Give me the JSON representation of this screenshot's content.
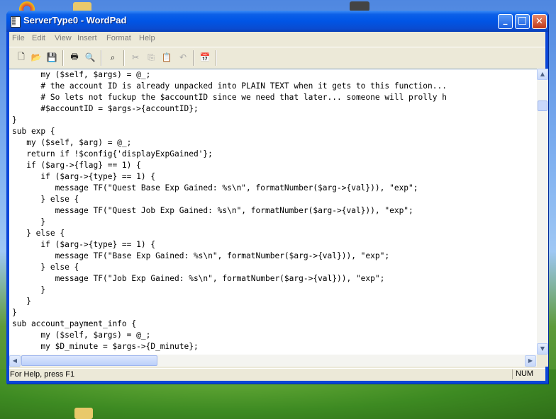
{
  "window": {
    "title": "ServerType0 - WordPad",
    "buttons": {
      "minimize": "_",
      "maximize": "□",
      "close": "✕"
    }
  },
  "menu": [
    "File",
    "Edit",
    "View",
    "Insert",
    "Format",
    "Help"
  ],
  "toolbar": {
    "new": "🗋",
    "open": "📂",
    "save": "💾",
    "print": "🖶",
    "preview": "🔍",
    "find": "⌕",
    "cut": "✂",
    "copy": "⎘",
    "paste": "📋",
    "undo": "↶",
    "datetime": "📅"
  },
  "document": {
    "lines": [
      "      my ($self, $args) = @_;",
      "      # the account ID is already unpacked into PLAIN TEXT when it gets to this function...",
      "      # So lets not fuckup the $accountID since we need that later... someone will prolly h",
      "      #$accountID = $args->{accountID};",
      "}",
      "sub exp {",
      "   my ($self, $arg) = @_;",
      "   return if !$config{'displayExpGained'};",
      "   if ($arg->{flag} == 1) {",
      "      if ($arg->{type} == 1) {",
      "         message TF(\"Quest Base Exp Gained: %s\\n\", formatNumber($arg->{val})), \"exp\";",
      "      } else {",
      "         message TF(\"Quest Job Exp Gained: %s\\n\", formatNumber($arg->{val})), \"exp\";",
      "      }",
      "   } else {",
      "      if ($arg->{type} == 1) {",
      "         message TF(\"Base Exp Gained: %s\\n\", formatNumber($arg->{val})), \"exp\";",
      "      } else {",
      "         message TF(\"Job Exp Gained: %s\\n\", formatNumber($arg->{val})), \"exp\";",
      "      }",
      "   }",
      "}",
      "sub account_payment_info {",
      "      my ($self, $args) = @_;",
      "      my $D_minute = $args->{D_minute};"
    ]
  },
  "scroll": {
    "up": "▲",
    "down": "▼",
    "left": "◀",
    "right": "▶"
  },
  "status": {
    "help": "For Help, press F1",
    "num": "NUM"
  },
  "cursor": "I"
}
